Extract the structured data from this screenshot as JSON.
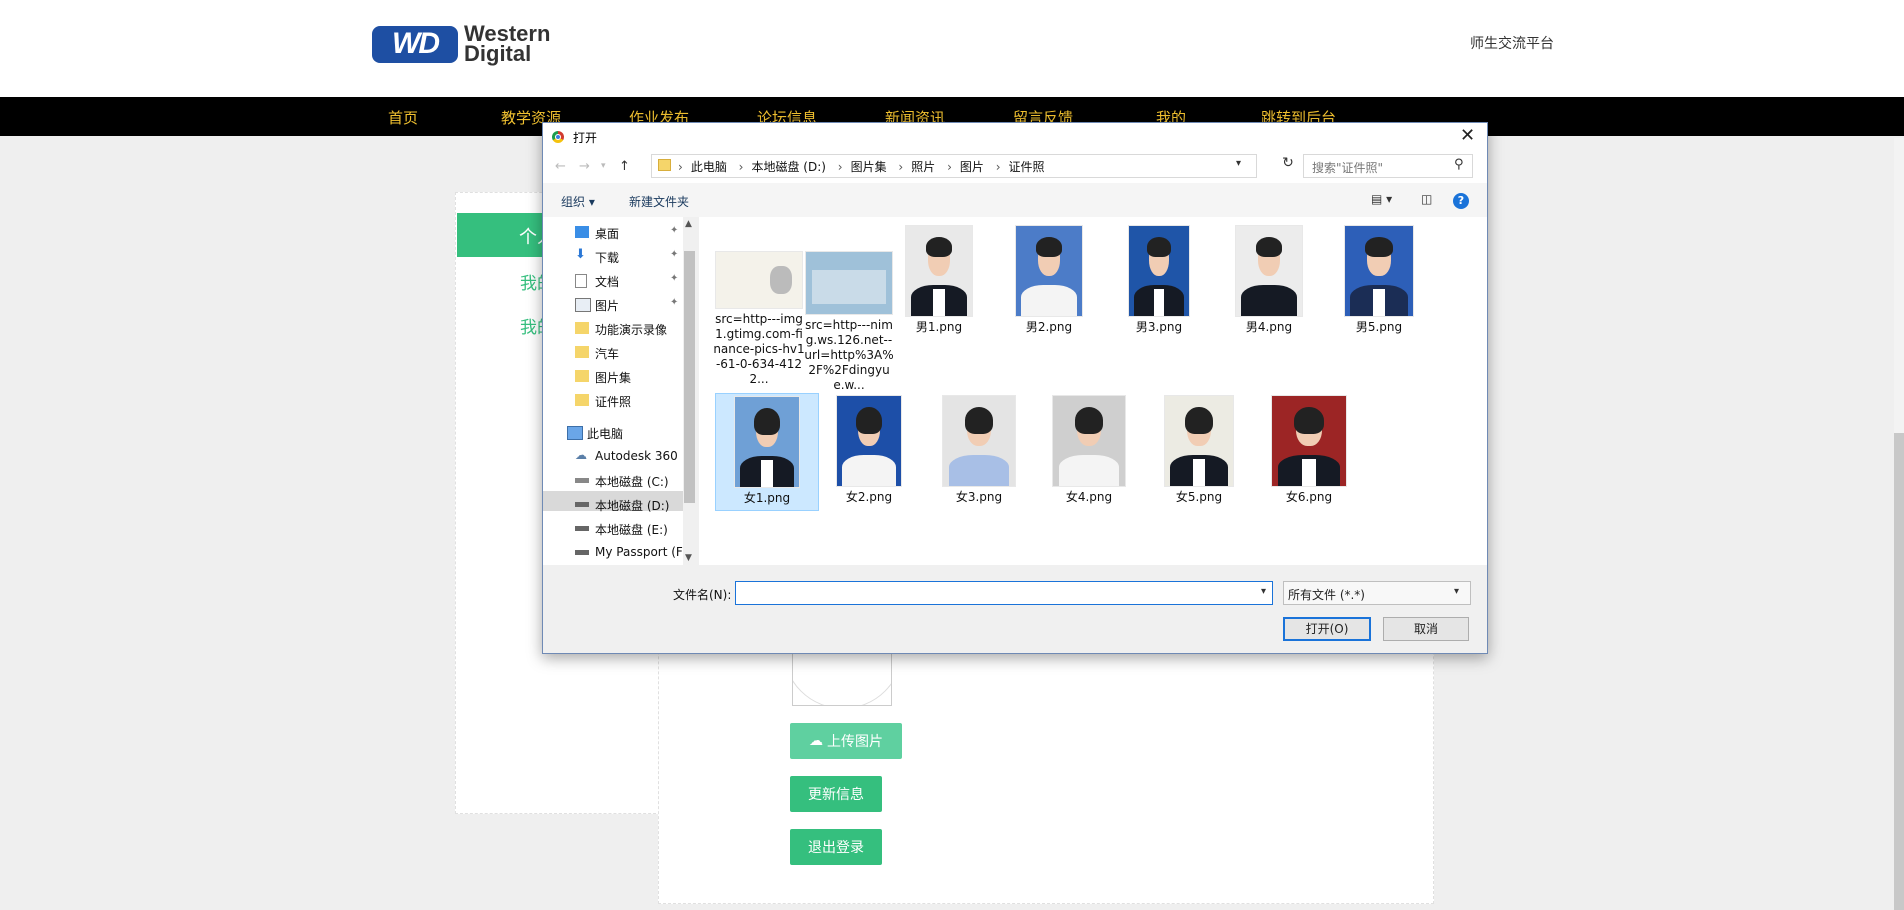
{
  "header": {
    "logo_text": "Western Digital",
    "logo_mark": "WD",
    "platform": "师生交流平台"
  },
  "nav": [
    "首页",
    "教学资源",
    "作业发布",
    "论坛信息",
    "新闻资讯",
    "留言反馈",
    "我的",
    "跳转到后台"
  ],
  "left_panel": {
    "title": "个人",
    "links": [
      "我的",
      "我的"
    ]
  },
  "profile": {
    "upload_label": "上传图片",
    "update_label": "更新信息",
    "logout_label": "退出登录"
  },
  "dialog": {
    "title": "打开",
    "breadcrumbs": [
      "此电脑",
      "本地磁盘 (D:)",
      "图片集",
      "照片",
      "图片",
      "证件照"
    ],
    "search_placeholder": "搜索\"证件照\"",
    "toolbar": {
      "organize": "组织 ▾",
      "new_folder": "新建文件夹"
    },
    "nav_items": [
      {
        "label": "桌面",
        "icon": "desktop-icon",
        "pinned": true
      },
      {
        "label": "下载",
        "icon": "download-icon",
        "pinned": true
      },
      {
        "label": "文档",
        "icon": "document-icon",
        "pinned": true
      },
      {
        "label": "图片",
        "icon": "pictures-icon",
        "pinned": true
      },
      {
        "label": "功能演示录像",
        "icon": "folder-icon"
      },
      {
        "label": "汽车",
        "icon": "folder-icon"
      },
      {
        "label": "图片集",
        "icon": "folder-icon"
      },
      {
        "label": "证件照",
        "icon": "folder-icon"
      },
      {
        "label": "此电脑",
        "icon": "computer-icon"
      },
      {
        "label": "Autodesk 360",
        "icon": "cloud-icon"
      },
      {
        "label": "本地磁盘 (C:)",
        "icon": "drive-icon"
      },
      {
        "label": "本地磁盘 (D:)",
        "icon": "drive-icon",
        "selected": true
      },
      {
        "label": "本地磁盘 (E:)",
        "icon": "drive-icon"
      },
      {
        "label": "My Passport (F",
        "icon": "drive-icon"
      }
    ],
    "files_row1": [
      {
        "name": "src=http---img1.gtimg.com-finance-pics-hv1-61-0-634-4122...",
        "kind": "idcard"
      },
      {
        "name": "src=http---nimg.ws.126.net--url=http%3A%2F%2Fdingyue.w...",
        "kind": "idcard2"
      },
      {
        "name": "男1.png",
        "kind": "man",
        "bg": "#e9e9e9"
      },
      {
        "name": "男2.png",
        "kind": "man",
        "bg": "#4c7cc8"
      },
      {
        "name": "男3.png",
        "kind": "man",
        "bg": "#1f55a8"
      },
      {
        "name": "男4.png",
        "kind": "man",
        "bg": "#ececec"
      },
      {
        "name": "男5.png",
        "kind": "man",
        "bg": "#2d5fb8"
      }
    ],
    "files_row2": [
      {
        "name": "女1.png",
        "kind": "woman",
        "bg": "#6fa0d6",
        "selected": true
      },
      {
        "name": "女2.png",
        "kind": "woman",
        "bg": "#1d4fa8"
      },
      {
        "name": "女3.png",
        "kind": "woman",
        "bg": "#e4e4e4"
      },
      {
        "name": "女4.png",
        "kind": "woman",
        "bg": "#cfcfcf"
      },
      {
        "name": "女5.png",
        "kind": "woman",
        "bg": "#ecebe3"
      },
      {
        "name": "女6.png",
        "kind": "woman",
        "bg": "#9c2525"
      }
    ],
    "filename_label": "文件名(N):",
    "filename_value": "",
    "filetype": "所有文件 (*.*)",
    "open_label": "打开(O)",
    "cancel_label": "取消"
  }
}
